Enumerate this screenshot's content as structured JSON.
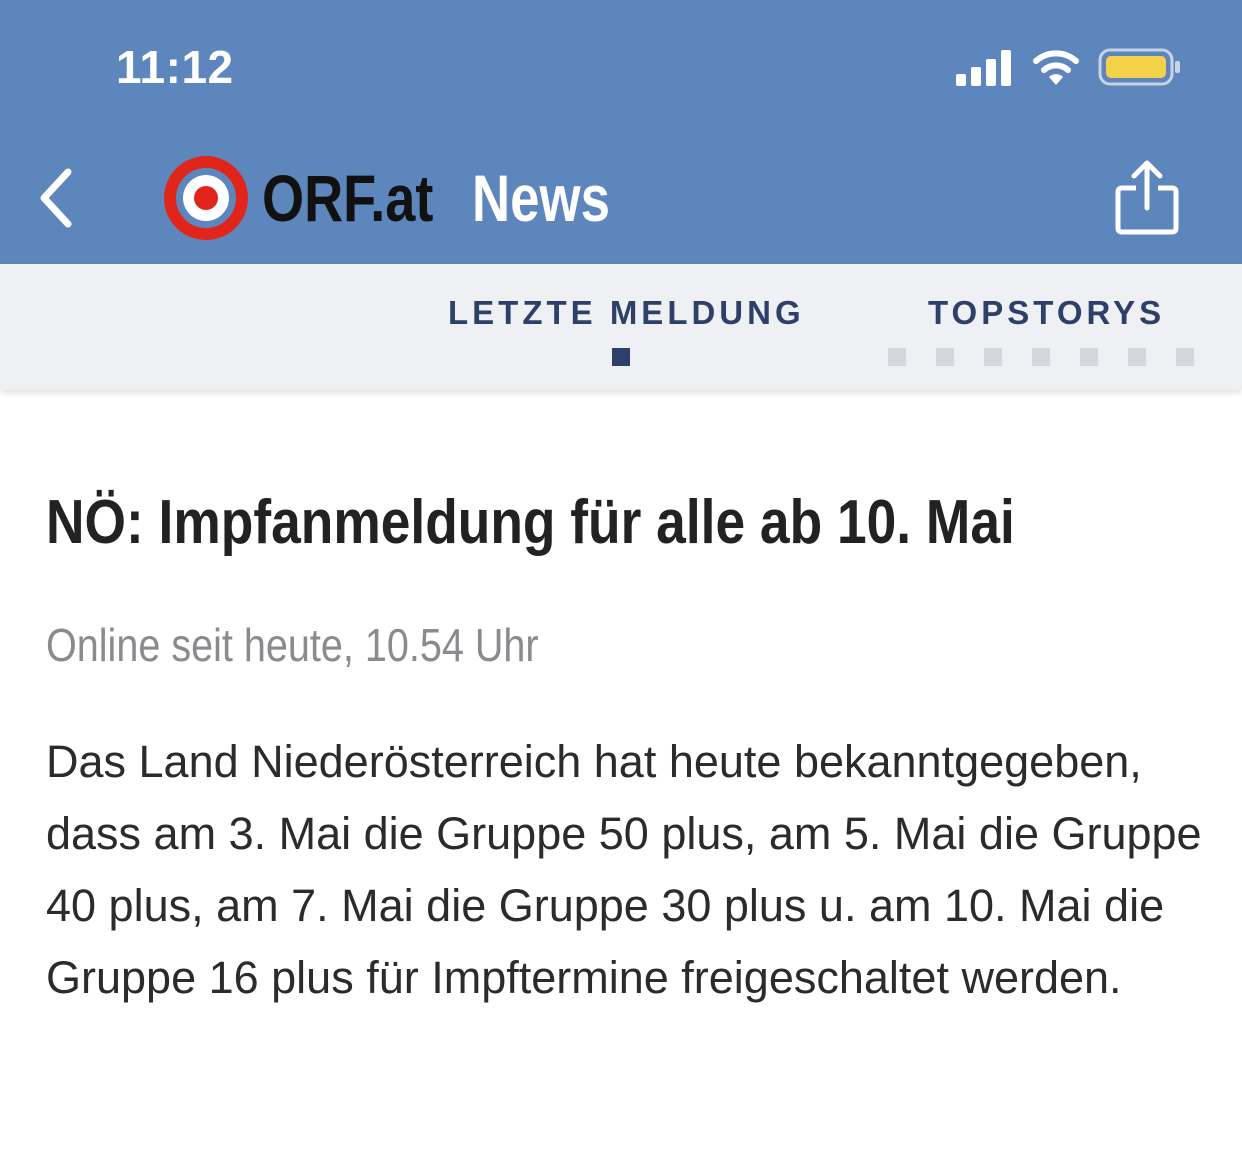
{
  "status_bar": {
    "time": "11:12",
    "icons": [
      "cellular-signal-icon",
      "wifi-icon",
      "battery-icon"
    ]
  },
  "nav": {
    "back_icon": "chevron-left-icon",
    "logo_icon": "orf-target-logo",
    "brand": "ORF.at",
    "section": "News",
    "share_icon": "share-icon"
  },
  "tabs": {
    "items": [
      {
        "label": "LETZTE MELDUNG",
        "active": true
      },
      {
        "label": "TOPSTORYS",
        "active": false
      }
    ],
    "page_indicator": {
      "count": 8,
      "active_index": 0
    }
  },
  "article": {
    "headline": "NÖ: Impfanmeldung für alle ab 10. Mai",
    "meta": "Online seit heute, 10.54 Uhr",
    "body": "Das Land Niederösterreich hat heute bekanntgegeben, dass am 3. Mai die Gruppe 50 plus, am 5. Mai die Gruppe 40 plus, am 7. Mai die Gruppe 30 plus u. am 10. Mai die Gruppe 16 plus für Impftermine freigeschaltet werden."
  },
  "colors": {
    "header_bg": "#5d86bd",
    "tabbar_bg": "#eef0f3",
    "tab_text": "#2e3f69",
    "logo_red": "#e1251b",
    "battery_fill": "#f5d24a"
  }
}
